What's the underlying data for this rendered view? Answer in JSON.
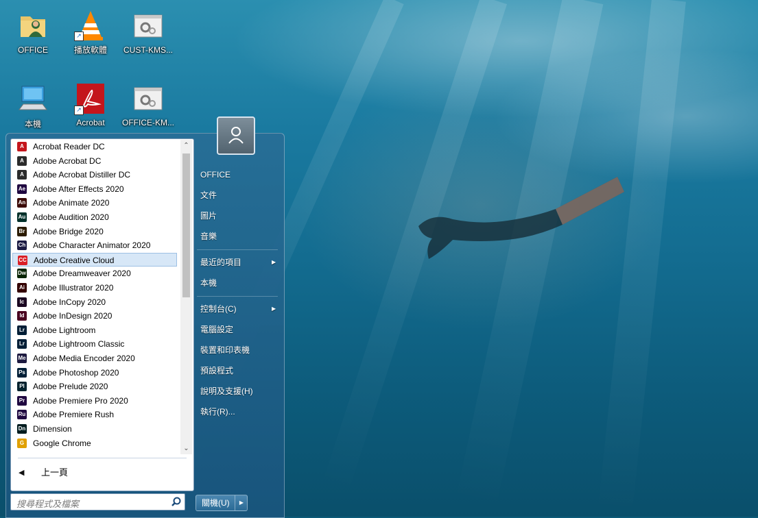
{
  "desktop": {
    "icons": [
      {
        "label": "OFFICE",
        "icon": "user-folder-icon"
      },
      {
        "label": "播放軟體",
        "icon": "vlc-icon"
      },
      {
        "label": "CUST-KMS...",
        "icon": "settings-file-icon"
      },
      {
        "label": "本機",
        "icon": "computer-icon"
      },
      {
        "label": "Acrobat",
        "icon": "acrobat-reader-icon"
      },
      {
        "label": "OFFICE-KM...",
        "icon": "settings-file-icon"
      }
    ]
  },
  "start_menu": {
    "programs": [
      {
        "label": "Acrobat Reader DC",
        "abbr": "A",
        "color": "#c4161c"
      },
      {
        "label": "Adobe Acrobat DC",
        "abbr": "A",
        "color": "#2b2b2b"
      },
      {
        "label": "Adobe Acrobat Distiller DC",
        "abbr": "A",
        "color": "#2b2b2b"
      },
      {
        "label": "Adobe After Effects 2020",
        "abbr": "Ae",
        "color": "#1f0740"
      },
      {
        "label": "Adobe Animate 2020",
        "abbr": "An",
        "color": "#3b0a06"
      },
      {
        "label": "Adobe Audition 2020",
        "abbr": "Au",
        "color": "#00302a"
      },
      {
        "label": "Adobe Bridge 2020",
        "abbr": "Br",
        "color": "#2b1b00"
      },
      {
        "label": "Adobe Character Animator 2020",
        "abbr": "Ch",
        "color": "#1a1942"
      },
      {
        "label": "Adobe Creative Cloud",
        "abbr": "CC",
        "color": "#da1f26",
        "selected": true
      },
      {
        "label": "Adobe Dreamweaver 2020",
        "abbr": "Dw",
        "color": "#072401"
      },
      {
        "label": "Adobe Illustrator 2020",
        "abbr": "Ai",
        "color": "#330000"
      },
      {
        "label": "Adobe InCopy 2020",
        "abbr": "Ic",
        "color": "#1a0620"
      },
      {
        "label": "Adobe InDesign 2020",
        "abbr": "Id",
        "color": "#49021f"
      },
      {
        "label": "Adobe Lightroom",
        "abbr": "Lr",
        "color": "#001e36"
      },
      {
        "label": "Adobe Lightroom Classic",
        "abbr": "Lr",
        "color": "#001e36"
      },
      {
        "label": "Adobe Media Encoder 2020",
        "abbr": "Me",
        "color": "#1d1a40"
      },
      {
        "label": "Adobe Photoshop 2020",
        "abbr": "Ps",
        "color": "#001e36"
      },
      {
        "label": "Adobe Prelude 2020",
        "abbr": "Pl",
        "color": "#00222e"
      },
      {
        "label": "Adobe Premiere Pro 2020",
        "abbr": "Pr",
        "color": "#1f0740"
      },
      {
        "label": "Adobe Premiere Rush",
        "abbr": "Ru",
        "color": "#1f0740"
      },
      {
        "label": "Dimension",
        "abbr": "Dn",
        "color": "#001c1f"
      },
      {
        "label": "Google Chrome",
        "abbr": "G",
        "color": "#e0a000"
      }
    ],
    "back_label": "上一頁",
    "search_placeholder": "搜尋程式及檔案",
    "right_items": [
      {
        "label": "OFFICE",
        "arrow": false
      },
      {
        "label": "文件",
        "arrow": false
      },
      {
        "label": "圖片",
        "arrow": false
      },
      {
        "label": "音樂",
        "arrow": false
      },
      {
        "label": "最近的項目",
        "arrow": true
      },
      {
        "label": "本機",
        "arrow": false
      },
      {
        "label": "控制台(C)",
        "arrow": true
      },
      {
        "label": "電腦設定",
        "arrow": false
      },
      {
        "label": "裝置和印表機",
        "arrow": false
      },
      {
        "label": "預設程式",
        "arrow": false
      },
      {
        "label": "說明及支援(H)",
        "arrow": false
      },
      {
        "label": "執行(R)...",
        "arrow": false
      }
    ],
    "shutdown_label": "關機(U)"
  }
}
